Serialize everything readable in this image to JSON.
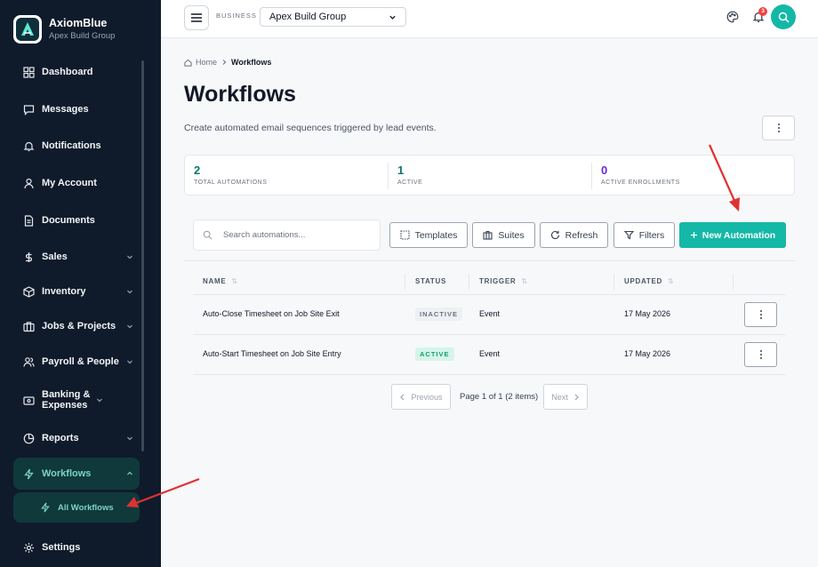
{
  "brand": {
    "name": "AxiomBlue",
    "subtitle": "Apex Build Group"
  },
  "sidebar": {
    "items": [
      {
        "label": "Dashboard",
        "icon": "grid-icon"
      },
      {
        "label": "Messages",
        "icon": "message-icon"
      },
      {
        "label": "Notifications",
        "icon": "bell-icon"
      },
      {
        "label": "My Account",
        "icon": "user-icon"
      },
      {
        "label": "Documents",
        "icon": "document-icon"
      },
      {
        "label": "Sales",
        "icon": "dollar-icon"
      },
      {
        "label": "Inventory",
        "icon": "box-icon"
      },
      {
        "label": "Jobs & Projects",
        "icon": "briefcase-icon"
      },
      {
        "label": "Payroll & People",
        "icon": "users-icon"
      },
      {
        "label": "Banking & Expenses",
        "icon": "wallet-icon"
      },
      {
        "label": "Reports",
        "icon": "pie-icon"
      },
      {
        "label": "Workflows",
        "icon": "bolt-icon"
      },
      {
        "label": "Settings",
        "icon": "gear-icon"
      }
    ],
    "sub_item": {
      "label": "All Workflows",
      "icon": "bolt-icon"
    }
  },
  "topbar": {
    "business_label": "BUSINESS",
    "business_selected": "Apex Build Group",
    "notification_count": "3"
  },
  "breadcrumb": {
    "home": "Home",
    "current": "Workflows"
  },
  "page": {
    "title": "Workflows",
    "description": "Create automated email sequences triggered by lead events."
  },
  "stats": [
    {
      "value": "2",
      "label": "TOTAL AUTOMATIONS",
      "color": "#0f766e"
    },
    {
      "value": "1",
      "label": "ACTIVE",
      "color": "#0f766e"
    },
    {
      "value": "0",
      "label": "ACTIVE ENROLLMENTS",
      "color": "#6d28d9"
    }
  ],
  "toolbar": {
    "search_placeholder": "Search automations...",
    "templates": "Templates",
    "suites": "Suites",
    "refresh": "Refresh",
    "filters": "Filters",
    "new_automation": "New Automation"
  },
  "table": {
    "columns": {
      "name": "NAME",
      "status": "STATUS",
      "trigger": "TRIGGER",
      "updated": "UPDATED"
    },
    "rows": [
      {
        "name": "Auto-Close Timesheet on Job Site Exit",
        "status": "INACTIVE",
        "trigger": "Event",
        "updated": "17 May 2026"
      },
      {
        "name": "Auto-Start Timesheet on Job Site Entry",
        "status": "ACTIVE",
        "trigger": "Event",
        "updated": "17 May 2026"
      }
    ]
  },
  "pagination": {
    "previous": "Previous",
    "info": "Page 1 of 1 (2 items)",
    "next": "Next"
  },
  "colors": {
    "accent": "#14b8a6",
    "sidebar": "#0f1b2b",
    "annotation_arrow": "#e03131"
  }
}
